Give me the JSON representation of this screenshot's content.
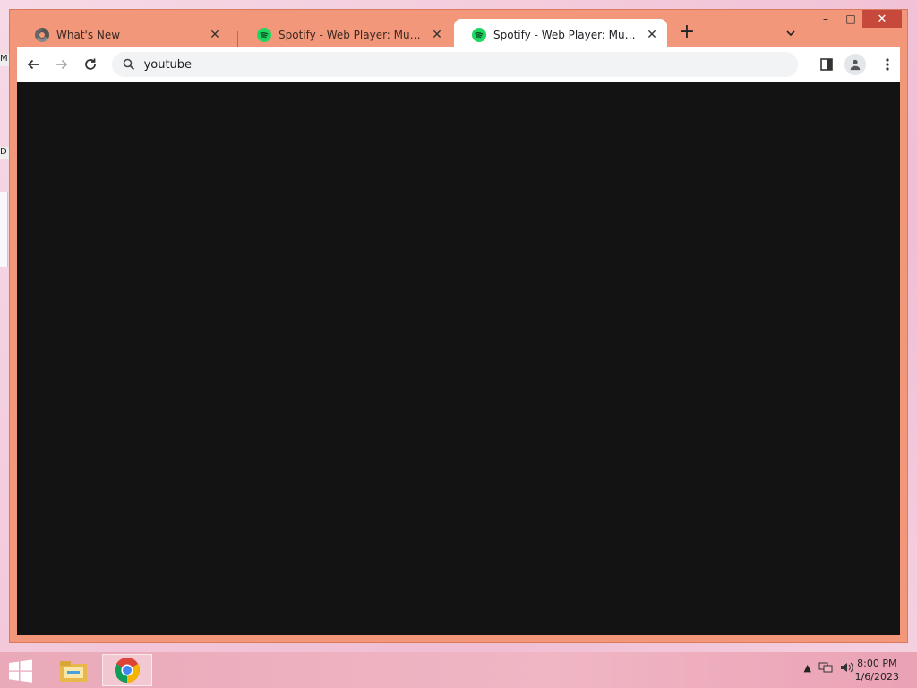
{
  "desktop": {
    "glimpse_top": "M",
    "glimpse_bottom": "D"
  },
  "browser": {
    "tabs": [
      {
        "title": "What's New",
        "favicon": "chrome-icon",
        "active": false
      },
      {
        "title": "Spotify - Web Player: Music for e",
        "favicon": "spotify-icon",
        "active": false
      },
      {
        "title": "Spotify - Web Player: Music for e",
        "favicon": "spotify-icon",
        "active": true
      }
    ],
    "close_glyph": "✕",
    "new_tab_glyph": "+",
    "window_controls": {
      "minimize": "–",
      "maximize": "□",
      "close": "✕"
    },
    "address_bar_value": "youtube",
    "content_background": "#131313",
    "frame_color": "#f2977a"
  },
  "taskbar": {
    "apps": [
      "file-explorer-icon",
      "chrome-icon"
    ],
    "time": "8:00 PM",
    "date": "1/6/2023",
    "tray_up_glyph": "▲"
  }
}
